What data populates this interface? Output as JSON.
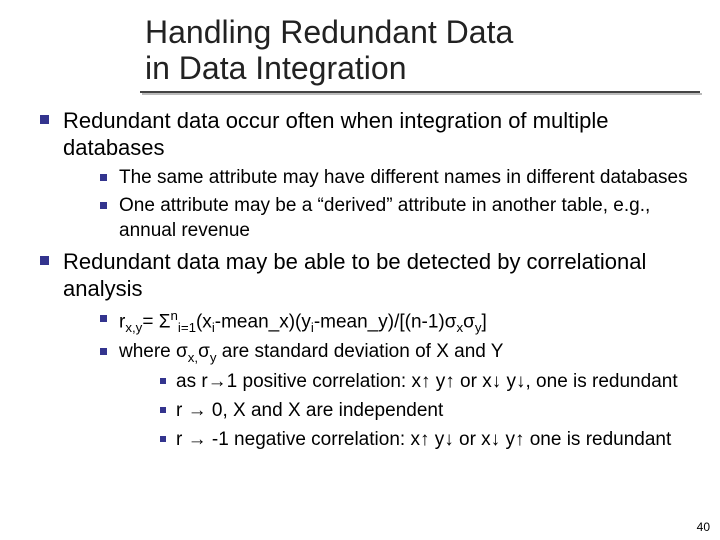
{
  "title_line1": "Handling Redundant Data",
  "title_line2": "in Data Integration",
  "p1": "Redundant data occur often when integration of multiple databases",
  "p1a": "The same attribute may have different names in different databases",
  "p1b": "One attribute may be a “derived” attribute in another table, e.g., annual revenue",
  "p2": "Redundant data may be able to be detected by correlational analysis",
  "p2a_prefix": "r",
  "p2a_sub1": "x,y",
  "p2a_mid1": "= Σ",
  "p2a_sup": "n",
  "p2a_subi": "i=1",
  "p2a_mid2": "(x",
  "p2a_subxi": "i",
  "p2a_mid3": "-mean_x)(y",
  "p2a_subyi": "i",
  "p2a_mid4": "-mean_y)/[(n-1)σ",
  "p2a_subx": "x",
  "p2a_mid5": "σ",
  "p2a_suby": "y",
  "p2a_end": "]",
  "p2b_pre": "where σ",
  "p2b_subx": "x,",
  "p2b_mid": "σ",
  "p2b_suby": "y",
  "p2b_post": " are  standard deviation of X and Y",
  "p2b1": "as r→1 positive correlation: x↑ y↑ or x↓ y↓, one is redundant",
  "p2b2": "r → 0, X and X are independent",
  "p2b3": "r → -1 negative correlation: x↑ y↓ or x↓ y↑ one is redundant",
  "slidenum": "40"
}
